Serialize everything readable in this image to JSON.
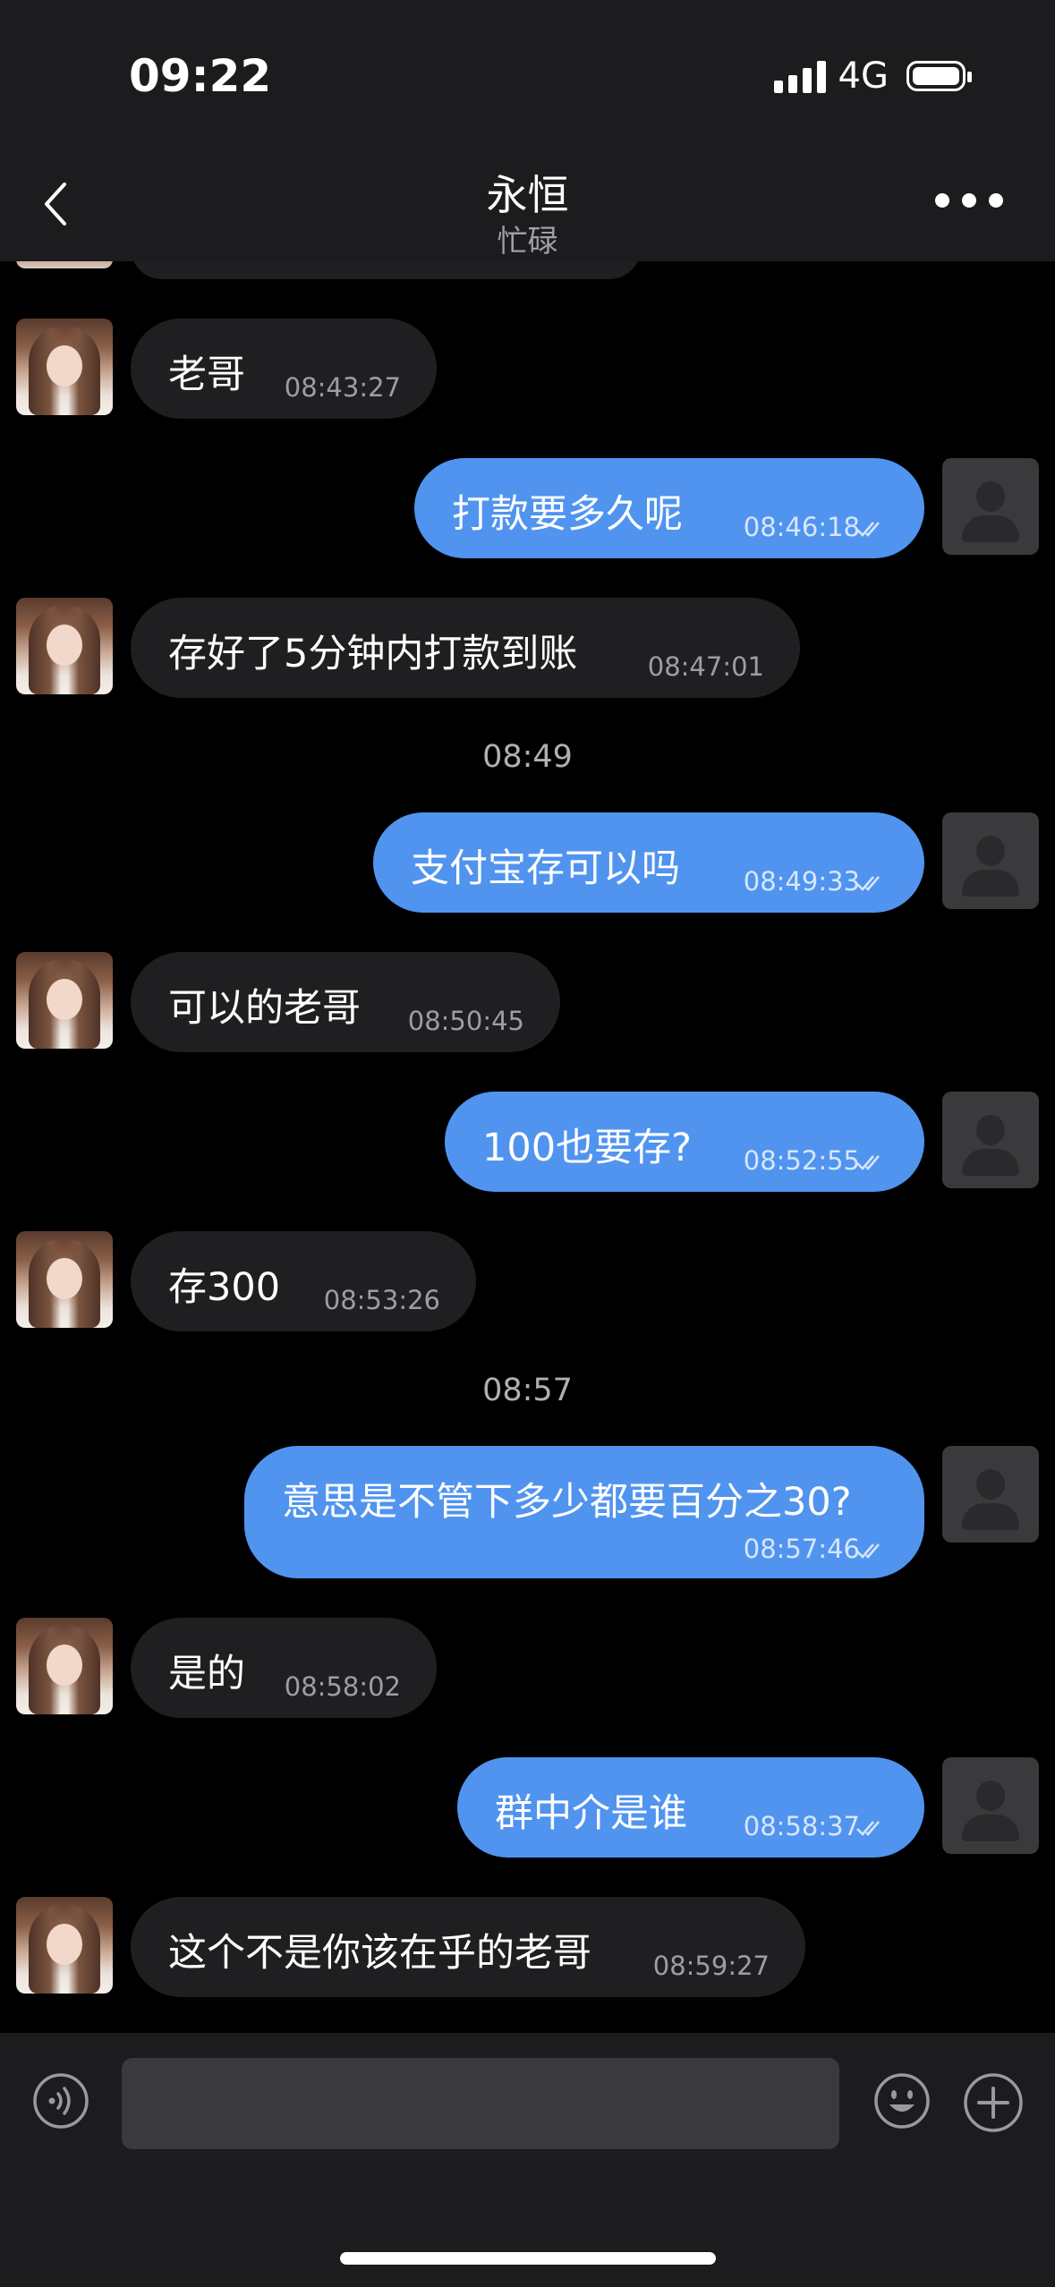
{
  "status": {
    "time": "09:22",
    "network": "4G"
  },
  "header": {
    "title": "永恒",
    "subtitle": "忙碌"
  },
  "messages": [
    {
      "text": "老哥",
      "time": "08:43:27"
    },
    {
      "text": "打款要多久呢",
      "time": "08:46:18"
    },
    {
      "text": "存好了5分钟内打款到账",
      "time": "08:47:01"
    },
    {
      "separator": "08:49"
    },
    {
      "text": "支付宝存可以吗",
      "time": "08:49:33"
    },
    {
      "text": "可以的老哥",
      "time": "08:50:45"
    },
    {
      "text": "100也要存?",
      "time": "08:52:55"
    },
    {
      "text": "存300",
      "time": "08:53:26"
    },
    {
      "separator": "08:57"
    },
    {
      "text": "意思是不管下多少都要百分之30?",
      "time": "08:57:46"
    },
    {
      "text": "是的",
      "time": "08:58:02"
    },
    {
      "text": "群中介是谁",
      "time": "08:58:37"
    },
    {
      "text": "这个不是你该在乎的老哥",
      "time": "08:59:27"
    }
  ],
  "input": {
    "value": "",
    "placeholder": ""
  },
  "colors": {
    "outgoing_bubble": "#5094ef",
    "incoming_bubble": "#1f1f21",
    "background": "#000000",
    "bar": "#1c1c1e"
  },
  "icons": [
    "back-icon",
    "more-icon",
    "voice-icon",
    "emoji-icon",
    "plus-icon",
    "read-ticks-icon"
  ]
}
